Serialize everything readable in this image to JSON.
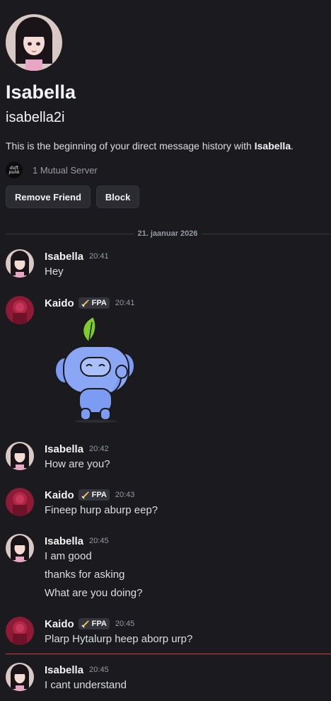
{
  "profile": {
    "display_name": "Isabella",
    "username": "isabella2i",
    "intro_prefix": "This is the beginning of your direct message history with ",
    "intro_name": "Isabella",
    "intro_suffix": ".",
    "mutual_servers": "1 Mutual Server",
    "server_icon_text": "daft punk"
  },
  "actions": {
    "remove_friend": "Remove Friend",
    "block": "Block"
  },
  "divider": {
    "date": "21. jaanuar 2026"
  },
  "messages": [
    {
      "author": "Isabella",
      "time": "20:41",
      "lines": [
        "Hey"
      ]
    },
    {
      "author": "Kaido",
      "tag": "FPA",
      "time": "20:41",
      "sticker": "wumpus-waving-sticker"
    },
    {
      "author": "Isabella",
      "time": "20:42",
      "lines": [
        "How are you?"
      ]
    },
    {
      "author": "Kaido",
      "tag": "FPA",
      "time": "20:43",
      "lines": [
        "Fineep hurp aburp eep?"
      ]
    },
    {
      "author": "Isabella",
      "time": "20:45",
      "lines": [
        "I am good",
        "thanks for asking",
        "What are you doing?"
      ]
    },
    {
      "author": "Kaido",
      "tag": "FPA",
      "time": "20:45",
      "lines": [
        "Plarp Hytalurp heep aborp urp?"
      ]
    },
    {
      "author": "Isabella",
      "time": "20:45",
      "lines": [
        "I cant understand"
      ]
    }
  ],
  "colors": {
    "background": "#1b1b1f",
    "button_bg": "#2b2c31",
    "new_message_line": "#d83c3e",
    "wumpus": "#7b9cf2"
  }
}
